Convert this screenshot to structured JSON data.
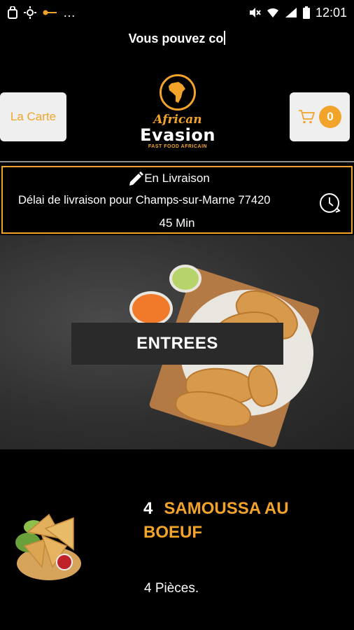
{
  "status_bar": {
    "time": "12:01",
    "left_icons": [
      "bag-icon",
      "sun-icon",
      "key-icon",
      "more-dots-icon"
    ],
    "right_icons": [
      "mute-icon",
      "wifi-icon",
      "signal-icon",
      "battery-icon"
    ]
  },
  "marquee": {
    "text": "Vous pouvez co"
  },
  "header": {
    "menu_button": "La Carte",
    "cart_count": "0",
    "logo": {
      "script": "African",
      "brand": "Evasion",
      "tagline": "FAST FOOD AFRICAIN"
    }
  },
  "delivery": {
    "mode": "En Livraison",
    "line": "Délai de livraison pour Champs-sur-Marne 77420",
    "time": "45 Min"
  },
  "section": {
    "label": "ENTREES"
  },
  "item": {
    "number": "4",
    "name": "SAMOUSSA AU BOEUF",
    "description": "4 Pièces."
  },
  "colors": {
    "accent": "#f2a42a",
    "background": "#000000",
    "button_bg": "#efefef"
  }
}
